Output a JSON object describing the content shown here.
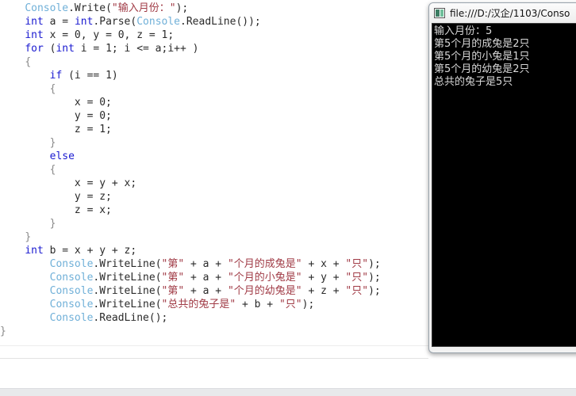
{
  "editor": {
    "name": "code-editor",
    "language": "C#",
    "lines": [
      {
        "indent": 4,
        "tokens": [
          {
            "t": "Console",
            "c": "cls"
          },
          {
            "t": ".Write(",
            "c": "plain"
          },
          {
            "t": "\"输入月份：\"",
            "c": "str"
          },
          {
            "t": ");",
            "c": "plain"
          }
        ]
      },
      {
        "indent": 4,
        "tokens": [
          {
            "t": "int",
            "c": "kw"
          },
          {
            "t": " a = ",
            "c": "plain"
          },
          {
            "t": "int",
            "c": "kw"
          },
          {
            "t": ".Parse(",
            "c": "plain"
          },
          {
            "t": "Console",
            "c": "cls"
          },
          {
            "t": ".ReadLine());",
            "c": "plain"
          }
        ]
      },
      {
        "indent": 4,
        "tokens": [
          {
            "t": "int",
            "c": "kw"
          },
          {
            "t": " x = 0, y = 0, z = 1;",
            "c": "plain"
          }
        ]
      },
      {
        "indent": 4,
        "tokens": [
          {
            "t": "for",
            "c": "kw"
          },
          {
            "t": " (",
            "c": "plain"
          },
          {
            "t": "int",
            "c": "kw"
          },
          {
            "t": " i = 1; i <= a;i++ )",
            "c": "plain"
          }
        ]
      },
      {
        "indent": 4,
        "tokens": [
          {
            "t": "{",
            "c": "brace"
          }
        ]
      },
      {
        "indent": 8,
        "tokens": [
          {
            "t": "if",
            "c": "kw"
          },
          {
            "t": " (i == 1)",
            "c": "plain"
          }
        ]
      },
      {
        "indent": 8,
        "tokens": [
          {
            "t": "{",
            "c": "brace"
          }
        ]
      },
      {
        "indent": 12,
        "tokens": [
          {
            "t": "x = 0;",
            "c": "plain"
          }
        ]
      },
      {
        "indent": 12,
        "tokens": [
          {
            "t": "y = 0;",
            "c": "plain"
          }
        ]
      },
      {
        "indent": 12,
        "tokens": [
          {
            "t": "z = 1;",
            "c": "plain"
          }
        ]
      },
      {
        "indent": 8,
        "tokens": [
          {
            "t": "}",
            "c": "brace"
          }
        ]
      },
      {
        "indent": 8,
        "tokens": [
          {
            "t": "else",
            "c": "kw"
          }
        ]
      },
      {
        "indent": 8,
        "tokens": [
          {
            "t": "{",
            "c": "brace"
          }
        ]
      },
      {
        "indent": 12,
        "tokens": [
          {
            "t": "x = y + x;",
            "c": "plain"
          }
        ]
      },
      {
        "indent": 12,
        "tokens": [
          {
            "t": "y = z;",
            "c": "plain"
          }
        ]
      },
      {
        "indent": 12,
        "tokens": [
          {
            "t": "z = x;",
            "c": "plain"
          }
        ]
      },
      {
        "indent": 8,
        "tokens": [
          {
            "t": "}",
            "c": "brace"
          }
        ]
      },
      {
        "indent": 4,
        "tokens": [
          {
            "t": "}",
            "c": "brace"
          }
        ]
      },
      {
        "indent": 4,
        "tokens": [
          {
            "t": "int",
            "c": "kw"
          },
          {
            "t": " b = x + y + z;",
            "c": "plain"
          }
        ]
      },
      {
        "indent": 8,
        "tokens": [
          {
            "t": "Console",
            "c": "cls"
          },
          {
            "t": ".WriteLine(",
            "c": "plain"
          },
          {
            "t": "\"第\"",
            "c": "str"
          },
          {
            "t": " + a + ",
            "c": "plain"
          },
          {
            "t": "\"个月的成兔是\"",
            "c": "str"
          },
          {
            "t": " + x + ",
            "c": "plain"
          },
          {
            "t": "\"只\"",
            "c": "str"
          },
          {
            "t": ");",
            "c": "plain"
          }
        ]
      },
      {
        "indent": 8,
        "tokens": [
          {
            "t": "Console",
            "c": "cls"
          },
          {
            "t": ".WriteLine(",
            "c": "plain"
          },
          {
            "t": "\"第\"",
            "c": "str"
          },
          {
            "t": " + a + ",
            "c": "plain"
          },
          {
            "t": "\"个月的小兔是\"",
            "c": "str"
          },
          {
            "t": " + y + ",
            "c": "plain"
          },
          {
            "t": "\"只\"",
            "c": "str"
          },
          {
            "t": ");",
            "c": "plain"
          }
        ]
      },
      {
        "indent": 8,
        "tokens": [
          {
            "t": "Console",
            "c": "cls"
          },
          {
            "t": ".WriteLine(",
            "c": "plain"
          },
          {
            "t": "\"第\"",
            "c": "str"
          },
          {
            "t": " + a + ",
            "c": "plain"
          },
          {
            "t": "\"个月的幼兔是\"",
            "c": "str"
          },
          {
            "t": " + z + ",
            "c": "plain"
          },
          {
            "t": "\"只\"",
            "c": "str"
          },
          {
            "t": ");",
            "c": "plain"
          }
        ]
      },
      {
        "indent": 8,
        "tokens": [
          {
            "t": "Console",
            "c": "cls"
          },
          {
            "t": ".WriteLine(",
            "c": "plain"
          },
          {
            "t": "\"总共的兔子是\"",
            "c": "str"
          },
          {
            "t": " + b + ",
            "c": "plain"
          },
          {
            "t": "\"只\"",
            "c": "str"
          },
          {
            "t": ");",
            "c": "plain"
          }
        ]
      },
      {
        "indent": 8,
        "tokens": [
          {
            "t": "Console",
            "c": "cls"
          },
          {
            "t": ".ReadLine();",
            "c": "plain"
          }
        ]
      },
      {
        "indent": 0,
        "tokens": [
          {
            "t": "}",
            "c": "brace"
          }
        ]
      }
    ]
  },
  "console_window": {
    "title": "file:///D:/汉企/1103/Conso",
    "icon": "console-app-icon",
    "output_lines": [
      "输入月份：5",
      "第5个月的成兔是2只",
      "第5个月的小兔是1只",
      "第5个月的幼兔是2只",
      "总共的兔子是5只"
    ]
  },
  "colors": {
    "keyword": "#1a1ad0",
    "class_name": "#70b0d8",
    "string": "#a03a45",
    "plain_text": "#2a2a2a",
    "brace": "#8a8a8a",
    "console_background": "#000000",
    "console_text": "#d8d8d8",
    "editor_background": "#ffffff",
    "bottom_strip": "#e8e9eb"
  }
}
